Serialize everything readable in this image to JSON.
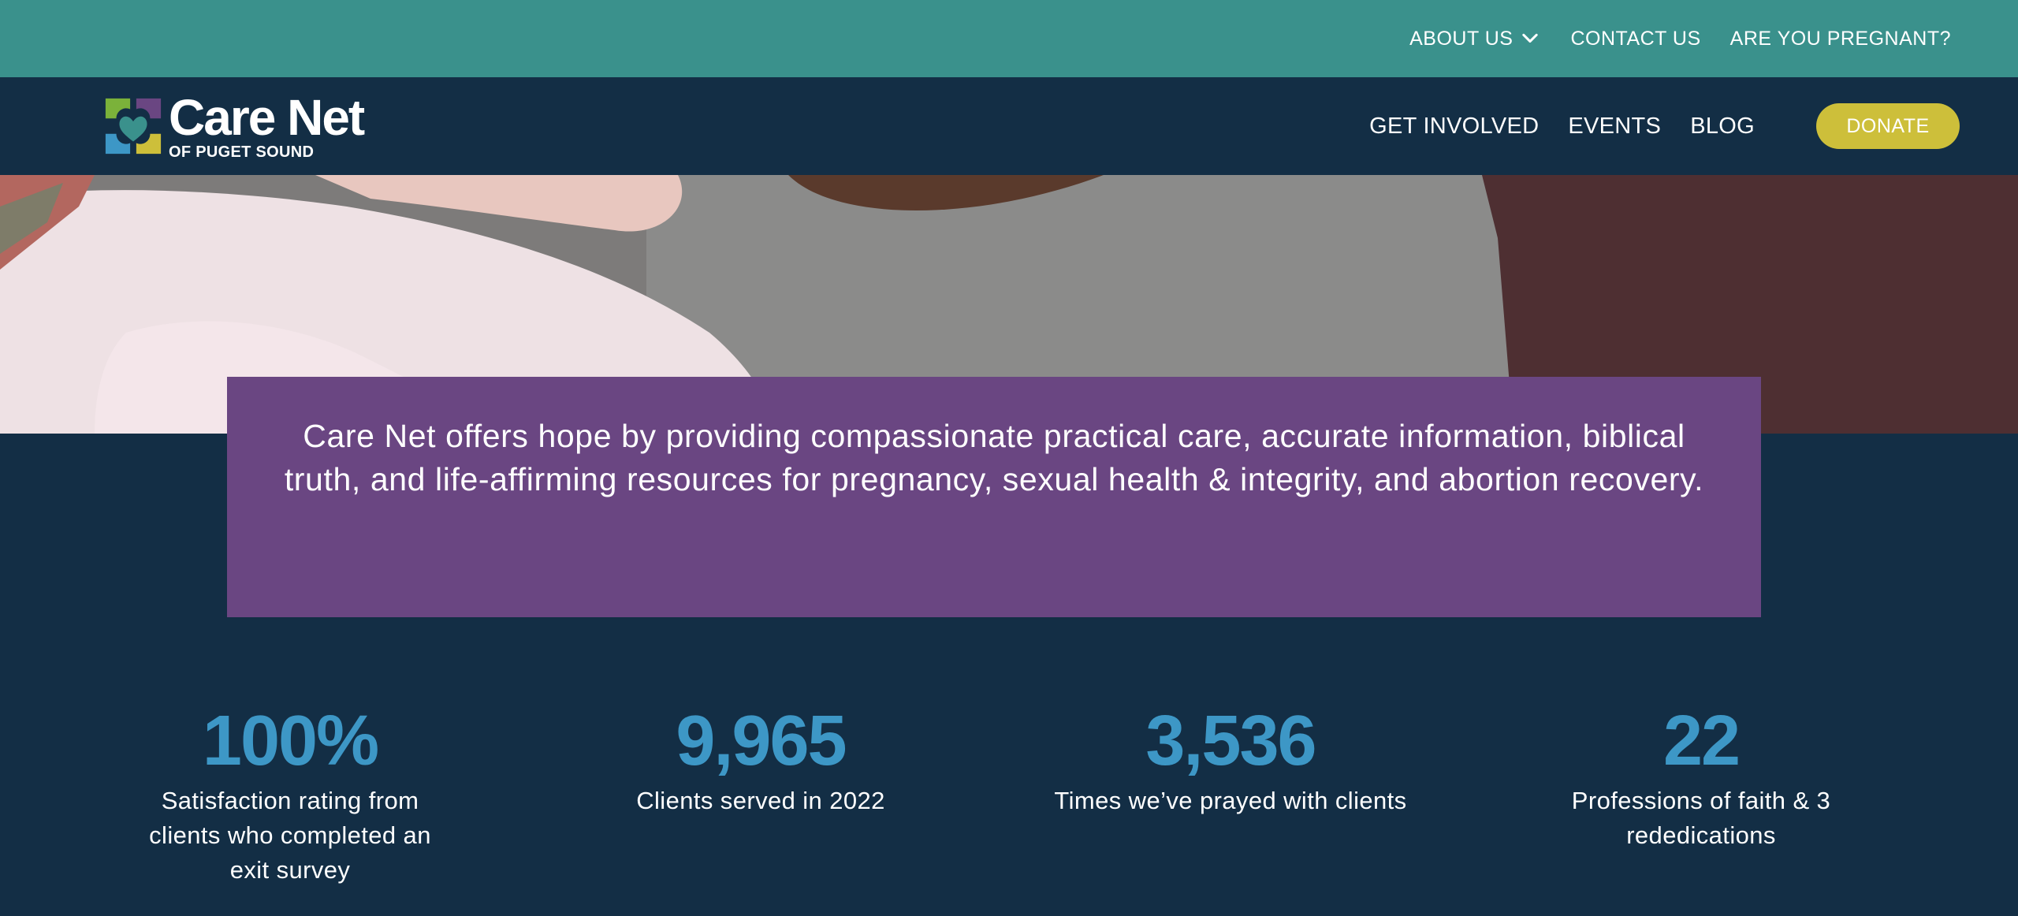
{
  "utility_nav": {
    "about_label": "ABOUT US",
    "contact_label": "CONTACT US",
    "pregnant_label": "ARE YOU PREGNANT?"
  },
  "brand": {
    "name": "Care Net",
    "subtitle": "OF PUGET SOUND",
    "icon": "care-net-heart-logo"
  },
  "main_nav": {
    "get_involved_label": "GET INVOLVED",
    "events_label": "EVENTS",
    "blog_label": "BLOG",
    "donate_label": "DONATE"
  },
  "mission": {
    "text": "Care Net offers hope by providing compassionate practical care, accurate information, biblical truth, and life-affirming resources for pregnancy, sexual health & integrity, and abortion recovery."
  },
  "stats": [
    {
      "number": "100%",
      "caption": "Satisfaction rating from clients who completed an exit survey"
    },
    {
      "number": "9,965",
      "caption": "Clients served in 2022"
    },
    {
      "number": "3,536",
      "caption": "Times we’ve prayed with clients"
    },
    {
      "number": "22",
      "caption": "Professions of faith & 3 rededications"
    }
  ],
  "colors": {
    "utility_bar": "#3a918c",
    "header": "#132e45",
    "mission_box": "#6a4682",
    "donate": "#cdbf3a",
    "stat_number": "#3d97c6"
  }
}
